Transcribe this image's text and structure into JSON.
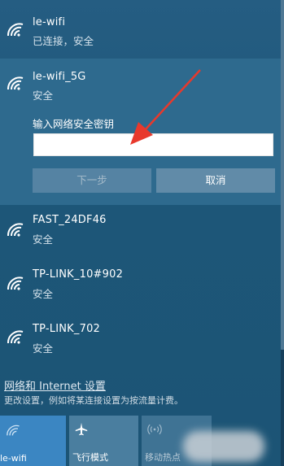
{
  "networks": [
    {
      "ssid": "le-wifi",
      "status": "已连接，安全"
    },
    {
      "ssid": "le-wifi_5G",
      "status": "安全"
    },
    {
      "ssid": "FAST_24DF46",
      "status": "安全"
    },
    {
      "ssid": "TP-LINK_10#902",
      "status": "安全"
    },
    {
      "ssid": "TP-LINK_702",
      "status": "安全"
    }
  ],
  "connect_form": {
    "prompt": "输入网络安全密钥",
    "key_value": "",
    "next_label": "下一步",
    "cancel_label": "取消"
  },
  "settings": {
    "link": "网络和 Internet 设置",
    "description": "更改设置，例如将某连接设置为按流量计费。"
  },
  "quick_actions": [
    {
      "label": "le-wifi",
      "icon": "wifi-icon",
      "active": true
    },
    {
      "label": "飞行模式",
      "icon": "airplane-icon",
      "active": false
    },
    {
      "label": "移动热点",
      "icon": "hotspot-icon",
      "active": false
    }
  ],
  "colors": {
    "panel": "#1f4f73",
    "selected": "#2e6a8e",
    "accent_tile": "#3b86c2",
    "arrow": "#e8392c"
  }
}
